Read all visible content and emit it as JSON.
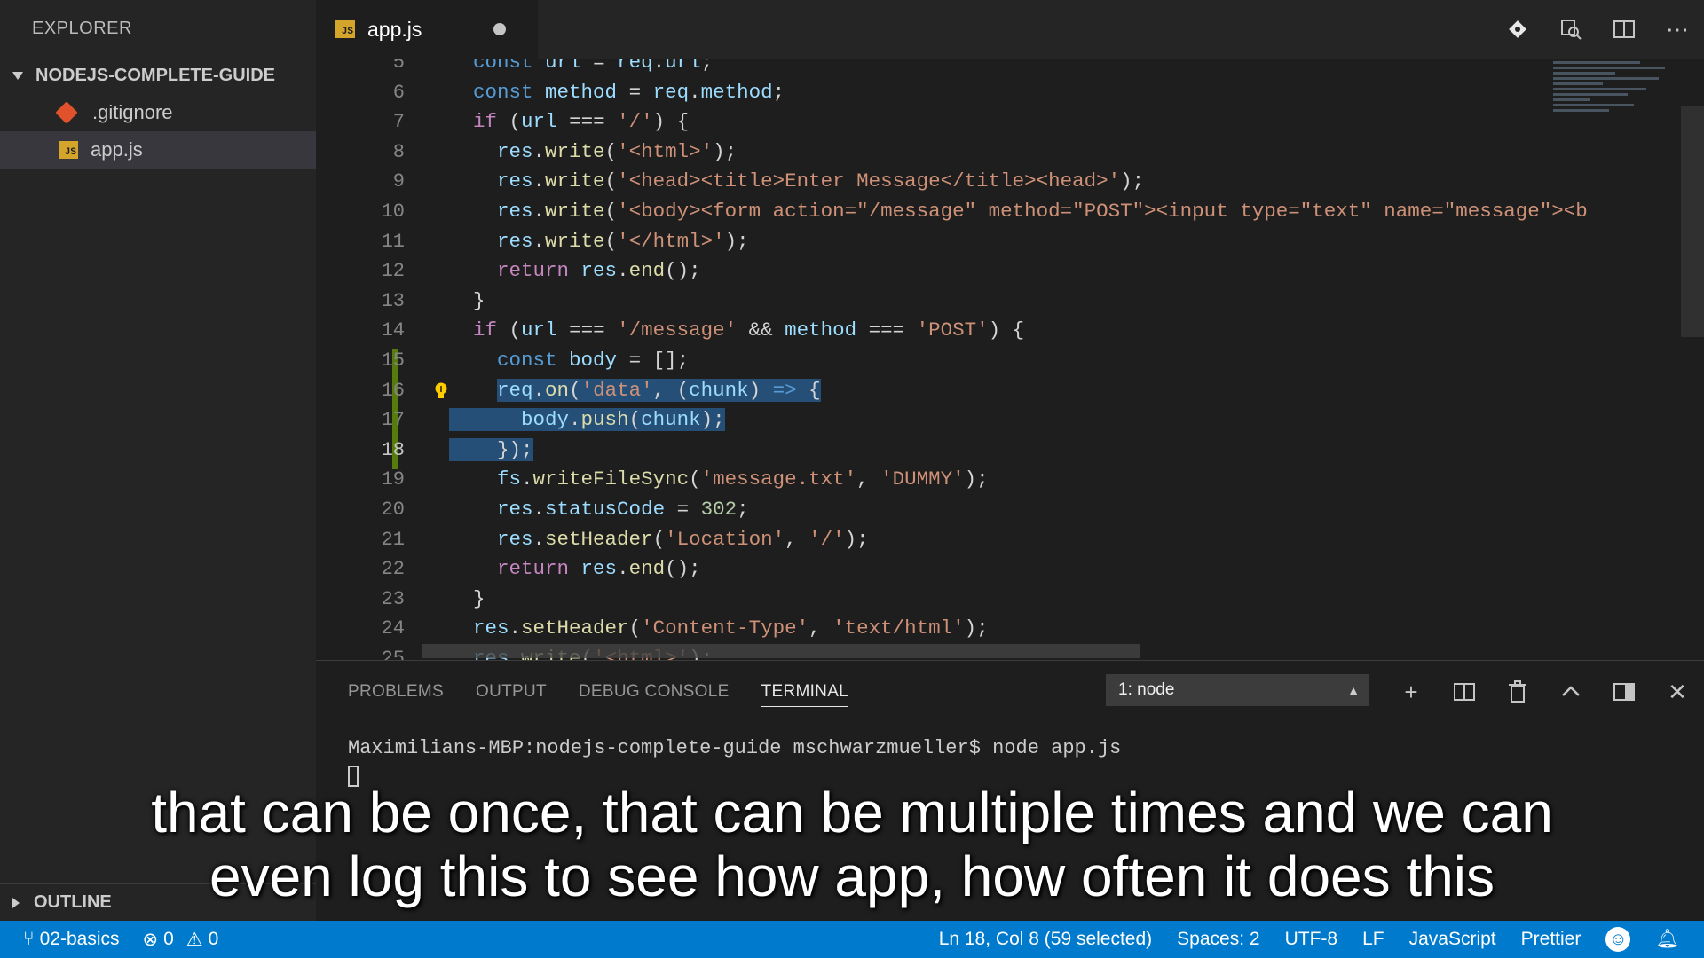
{
  "sidebar": {
    "title": "EXPLORER",
    "folder": "NODEJS-COMPLETE-GUIDE",
    "files": [
      {
        "name": ".gitignore",
        "icon": "git-icon"
      },
      {
        "name": "app.js",
        "icon": "js-icon",
        "active": true
      }
    ],
    "outline": "OUTLINE"
  },
  "tab": {
    "filename": "app.js",
    "icon_text": "JS",
    "unsaved": true
  },
  "editor": {
    "line_numbers": [
      "5",
      "6",
      "7",
      "8",
      "9",
      "10",
      "11",
      "12",
      "13",
      "14",
      "15",
      "16",
      "17",
      "18",
      "19",
      "20",
      "21",
      "22",
      "23",
      "24",
      "25"
    ],
    "current_line": "18"
  },
  "panel": {
    "tabs": [
      "PROBLEMS",
      "OUTPUT",
      "DEBUG CONSOLE",
      "TERMINAL"
    ],
    "active_tab": "TERMINAL",
    "terminal_selector": "1: node",
    "terminal_prompt": "Maximilians-MBP:nodejs-complete-guide mschwarzmueller$ node app.js"
  },
  "statusbar": {
    "branch": "02-basics",
    "errors": "0",
    "warnings": "0",
    "position": "Ln 18, Col 8 (59 selected)",
    "spaces": "Spaces: 2",
    "encoding": "UTF-8",
    "eol": "LF",
    "language": "JavaScript",
    "formatter": "Prettier"
  },
  "subtitle": {
    "line1": "that can be once, that can be multiple times and we can",
    "line2": "even log this to see how app, how often it does this"
  },
  "colors": {
    "statusbar": "#007acc",
    "selection": "#264f78",
    "modified": "#587c0c"
  }
}
